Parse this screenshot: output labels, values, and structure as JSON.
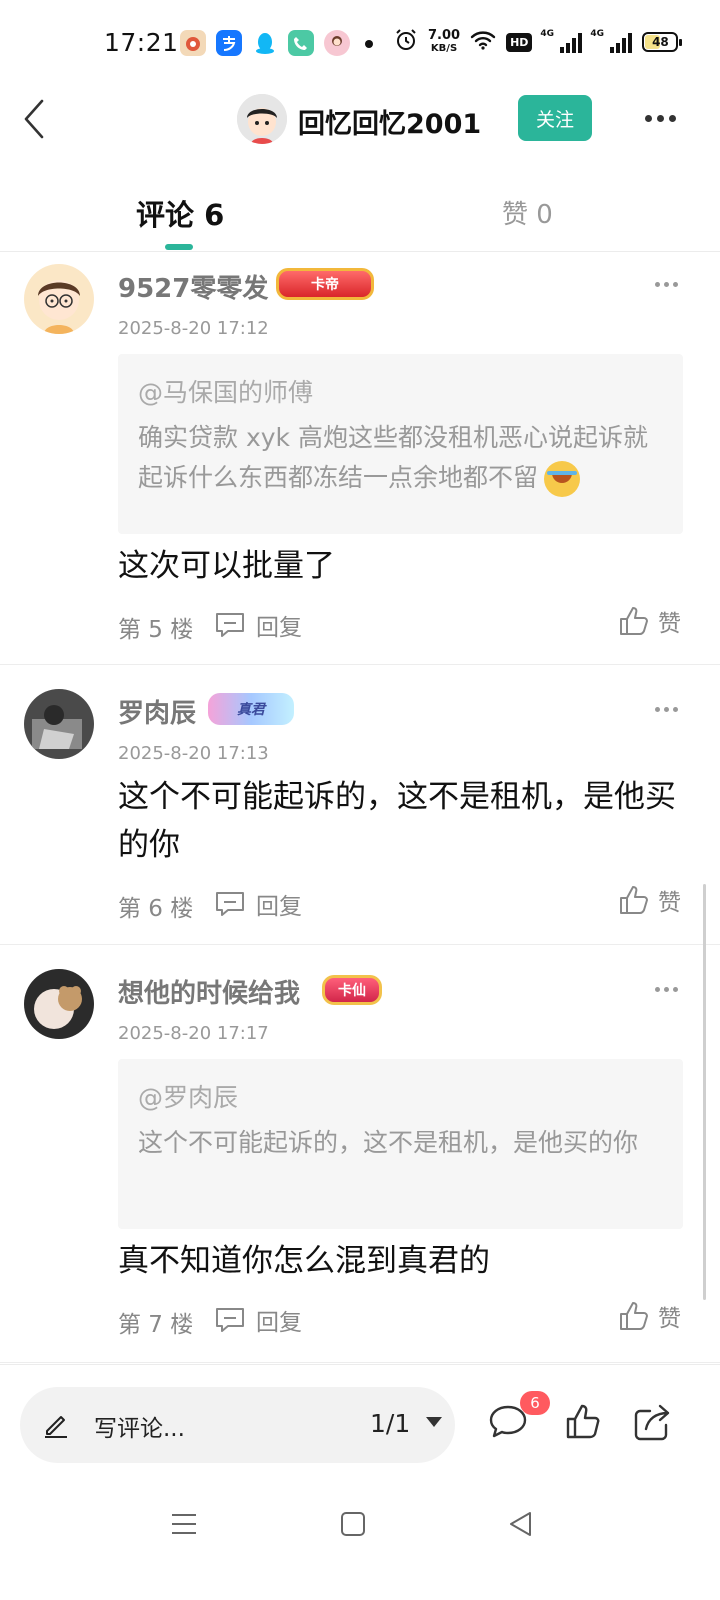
{
  "status_bar": {
    "time": "17:21",
    "net_speed_value": "7.00",
    "net_speed_unit": "KB/S",
    "hd_label": "HD",
    "signal1_label": "4G",
    "signal2_label": "4G",
    "battery_level": "48",
    "app_icons": [
      "pinduoduo-icon",
      "alipay-icon",
      "qq-icon",
      "phone-icon",
      "avatar-app-icon"
    ]
  },
  "header": {
    "user_name": "回忆回忆2001",
    "follow_label": "关注"
  },
  "tabs": {
    "comments_label": "评论 6",
    "likes_label": "赞 0"
  },
  "comments": [
    {
      "name": "9527零零发",
      "badge": "卡帝",
      "time": "2025-8-20 17:12",
      "quote_user": "@马保国的师傅",
      "quote_text": "确实贷款 xyk 高炮这些都没租机恶心说起诉就起诉什么东西都冻结一点余地都不留",
      "body": "这次可以批量了",
      "floor": "第 5 楼",
      "reply_label": "回复",
      "like_label": "赞"
    },
    {
      "name": "罗肉辰",
      "badge": "真君",
      "time": "2025-8-20 17:13",
      "body": "这个不可能起诉的，这不是租机，是他买的你",
      "floor": "第 6 楼",
      "reply_label": "回复",
      "like_label": "赞"
    },
    {
      "name": "想他的时候给我",
      "badge": "卡仙",
      "time": "2025-8-20 17:17",
      "quote_user": "@罗肉辰",
      "quote_text": "这个不可能起诉的，这不是租机，是他买的你",
      "body": "真不知道你怎么混到真君的",
      "floor": "第 7 楼",
      "reply_label": "回复",
      "like_label": "赞"
    }
  ],
  "bottom_bar": {
    "input_placeholder": "写评论...",
    "page_indicator": "1/1",
    "comment_count": "6"
  },
  "colors": {
    "accent": "#2bb59a",
    "badge_red": "#ff5a5f"
  }
}
